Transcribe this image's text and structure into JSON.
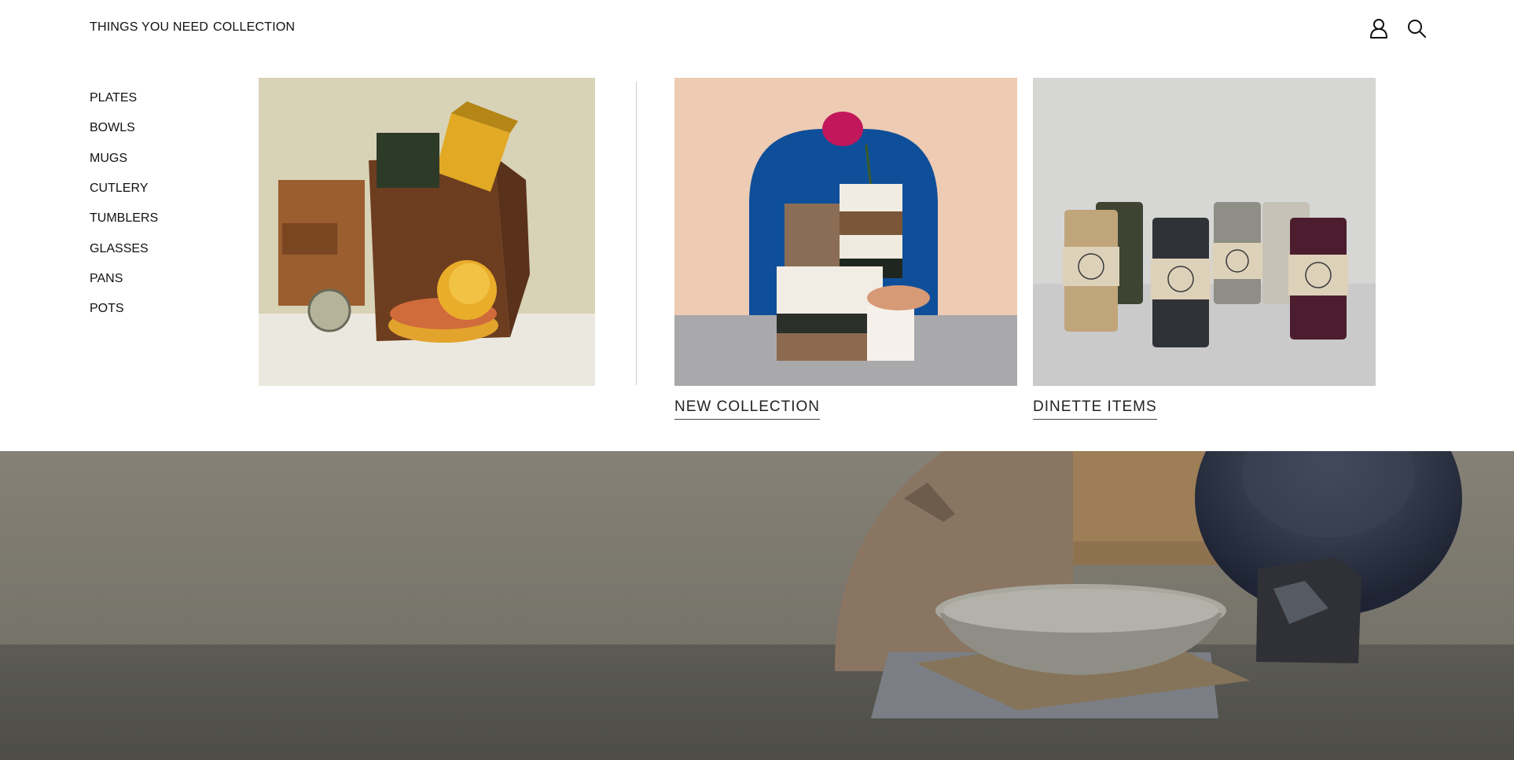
{
  "nav": {
    "links": [
      "THINGS YOU NEED",
      "COLLECTION"
    ],
    "icons": [
      "account-icon",
      "search-icon"
    ]
  },
  "menu": {
    "categories": [
      "PLATES",
      "BOWLS",
      "MUGS",
      "CUTLERY",
      "TUMBLERS",
      "GLASSES",
      "PANS",
      "POTS"
    ],
    "promos": [
      {
        "caption": "NEW COLLECTION"
      },
      {
        "caption": "DINETTE ITEMS"
      }
    ]
  },
  "colors": {
    "accent_blue": "#0f4f9a",
    "peach": "#eecbb3",
    "hero_wall": "#7e7a70",
    "hero_floor": "#56554f"
  }
}
